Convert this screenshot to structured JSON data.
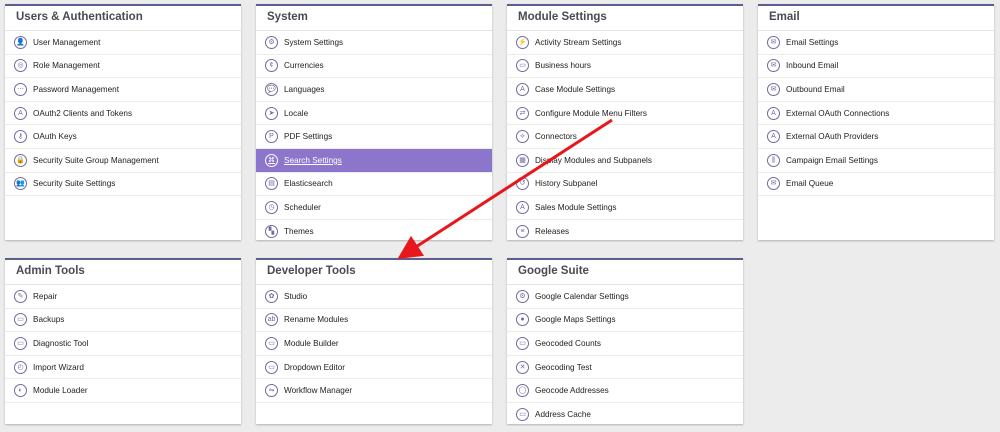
{
  "panels": {
    "users": {
      "title": "Users & Authentication",
      "items": [
        {
          "label": "User Management",
          "icon": "user-icon",
          "glyph": "👤"
        },
        {
          "label": "Role Management",
          "icon": "role-icon",
          "glyph": "◎"
        },
        {
          "label": "Password Management",
          "icon": "password-icon",
          "glyph": "⋯"
        },
        {
          "label": "OAuth2 Clients and Tokens",
          "icon": "oauth-icon",
          "glyph": "A"
        },
        {
          "label": "OAuth Keys",
          "icon": "key-icon",
          "glyph": "⚷"
        },
        {
          "label": "Security Suite Group Management",
          "icon": "lock-icon",
          "glyph": "🔒"
        },
        {
          "label": "Security Suite Settings",
          "icon": "users-icon",
          "glyph": "👥"
        }
      ]
    },
    "system": {
      "title": "System",
      "items": [
        {
          "label": "System Settings",
          "icon": "gear-icon",
          "glyph": "⚙"
        },
        {
          "label": "Currencies",
          "icon": "currency-icon",
          "glyph": "¢"
        },
        {
          "label": "Languages",
          "icon": "languages-icon",
          "glyph": "💬"
        },
        {
          "label": "Locale",
          "icon": "locale-icon",
          "glyph": "➤"
        },
        {
          "label": "PDF Settings",
          "icon": "pdf-icon",
          "glyph": "P"
        },
        {
          "label": "Search Settings",
          "icon": "search-settings-icon",
          "glyph": "⌘"
        },
        {
          "label": "Elasticsearch",
          "icon": "elasticsearch-icon",
          "glyph": "▤"
        },
        {
          "label": "Scheduler",
          "icon": "scheduler-icon",
          "glyph": "◷"
        },
        {
          "label": "Themes",
          "icon": "themes-icon",
          "glyph": "▚"
        }
      ]
    },
    "module_settings": {
      "title": "Module Settings",
      "items": [
        {
          "label": "Activity Stream Settings",
          "icon": "activity-icon",
          "glyph": "⚡"
        },
        {
          "label": "Business hours",
          "icon": "business-hours-icon",
          "glyph": "▭"
        },
        {
          "label": "Case Module Settings",
          "icon": "case-icon",
          "glyph": "A"
        },
        {
          "label": "Configure Module Menu Filters",
          "icon": "filters-icon",
          "glyph": "⇄"
        },
        {
          "label": "Connectors",
          "icon": "connectors-icon",
          "glyph": "⟡"
        },
        {
          "label": "Display Modules and Subpanels",
          "icon": "display-icon",
          "glyph": "▦"
        },
        {
          "label": "History Subpanel",
          "icon": "history-icon",
          "glyph": "↺"
        },
        {
          "label": "Sales Module Settings",
          "icon": "sales-icon",
          "glyph": "A"
        },
        {
          "label": "Releases",
          "icon": "releases-icon",
          "glyph": "≡"
        }
      ]
    },
    "email": {
      "title": "Email",
      "items": [
        {
          "label": "Email Settings",
          "icon": "email-icon",
          "glyph": "✉"
        },
        {
          "label": "Inbound Email",
          "icon": "inbound-email-icon",
          "glyph": "✉"
        },
        {
          "label": "Outbound Email",
          "icon": "outbound-email-icon",
          "glyph": "✉"
        },
        {
          "label": "External OAuth Connections",
          "icon": "oauth-connections-icon",
          "glyph": "A"
        },
        {
          "label": "External OAuth Providers",
          "icon": "oauth-providers-icon",
          "glyph": "A"
        },
        {
          "label": "Campaign Email Settings",
          "icon": "campaign-icon",
          "glyph": "⫼"
        },
        {
          "label": "Email Queue",
          "icon": "email-queue-icon",
          "glyph": "✉"
        }
      ]
    },
    "admin_tools": {
      "title": "Admin Tools",
      "items": [
        {
          "label": "Repair",
          "icon": "wrench-icon",
          "glyph": "✎"
        },
        {
          "label": "Backups",
          "icon": "backup-icon",
          "glyph": "▭"
        },
        {
          "label": "Diagnostic Tool",
          "icon": "diagnostic-icon",
          "glyph": "▭"
        },
        {
          "label": "Import Wizard",
          "icon": "import-icon",
          "glyph": "◴"
        },
        {
          "label": "Module Loader",
          "icon": "module-loader-icon",
          "glyph": "◐"
        }
      ]
    },
    "developer_tools": {
      "title": "Developer Tools",
      "items": [
        {
          "label": "Studio",
          "icon": "studio-icon",
          "glyph": "✿"
        },
        {
          "label": "Rename Modules",
          "icon": "rename-icon",
          "glyph": "ab"
        },
        {
          "label": "Module Builder",
          "icon": "module-builder-icon",
          "glyph": "▭"
        },
        {
          "label": "Dropdown Editor",
          "icon": "dropdown-editor-icon",
          "glyph": "▭"
        },
        {
          "label": "Workflow Manager",
          "icon": "workflow-icon",
          "glyph": "⇋"
        }
      ]
    },
    "google_suite": {
      "title": "Google Suite",
      "items": [
        {
          "label": "Google Calendar Settings",
          "icon": "calendar-settings-icon",
          "glyph": "⚙"
        },
        {
          "label": "Google Maps Settings",
          "icon": "map-pin-icon",
          "glyph": "●"
        },
        {
          "label": "Geocoded Counts",
          "icon": "geocoded-counts-icon",
          "glyph": "▭"
        },
        {
          "label": "Geocoding Test",
          "icon": "geocoding-test-icon",
          "glyph": "✕"
        },
        {
          "label": "Geocode Addresses",
          "icon": "geocode-addresses-icon",
          "glyph": "◯"
        },
        {
          "label": "Address Cache",
          "icon": "address-cache-icon",
          "glyph": "▭"
        }
      ]
    }
  },
  "active_item": "Search Settings",
  "colors": {
    "active_bg": "#8b76cc",
    "panel_border": "#5a5f8f",
    "arrow": "#e8171b"
  }
}
